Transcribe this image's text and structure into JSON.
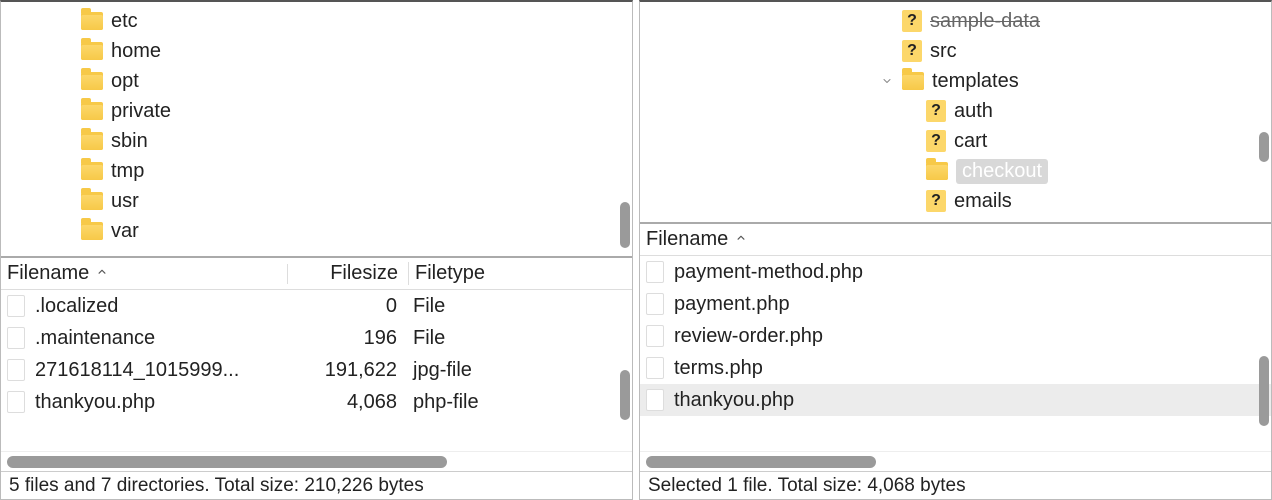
{
  "left": {
    "tree": [
      {
        "name": "etc",
        "icon": "folder"
      },
      {
        "name": "home",
        "icon": "folder"
      },
      {
        "name": "opt",
        "icon": "folder"
      },
      {
        "name": "private",
        "icon": "folder"
      },
      {
        "name": "sbin",
        "icon": "folder"
      },
      {
        "name": "tmp",
        "icon": "folder"
      },
      {
        "name": "usr",
        "icon": "folder"
      },
      {
        "name": "var",
        "icon": "folder"
      }
    ],
    "columns": {
      "name": "Filename",
      "size": "Filesize",
      "type": "Filetype"
    },
    "files": [
      {
        "name": ".localized",
        "size": "0",
        "type": "File"
      },
      {
        "name": ".maintenance",
        "size": "196",
        "type": "File"
      },
      {
        "name": "271618114_1015999...",
        "size": "191,622",
        "type": "jpg-file"
      },
      {
        "name": "thankyou.php",
        "size": "4,068",
        "type": "php-file"
      }
    ],
    "status": "5 files and 7 directories. Total size: 210,226 bytes"
  },
  "right": {
    "tree": [
      {
        "name": "sample-data",
        "icon": "qfile",
        "depth": 3,
        "strike": true,
        "chevron": false
      },
      {
        "name": "src",
        "icon": "qfile",
        "depth": 3,
        "chevron": false
      },
      {
        "name": "templates",
        "icon": "folder",
        "depth": 3,
        "chevron": true,
        "expanded": true
      },
      {
        "name": "auth",
        "icon": "qfile",
        "depth": 4,
        "chevron": false
      },
      {
        "name": "cart",
        "icon": "qfile",
        "depth": 4,
        "chevron": false
      },
      {
        "name": "checkout",
        "icon": "folder",
        "depth": 4,
        "chevron": false,
        "selected": true
      },
      {
        "name": "emails",
        "icon": "qfile",
        "depth": 4,
        "chevron": false
      }
    ],
    "columns": {
      "name": "Filename"
    },
    "files": [
      {
        "name": "payment-method.php"
      },
      {
        "name": "payment.php"
      },
      {
        "name": "review-order.php"
      },
      {
        "name": "terms.php"
      },
      {
        "name": "thankyou.php",
        "selected": true
      }
    ],
    "status": "Selected 1 file. Total size: 4,068 bytes"
  }
}
